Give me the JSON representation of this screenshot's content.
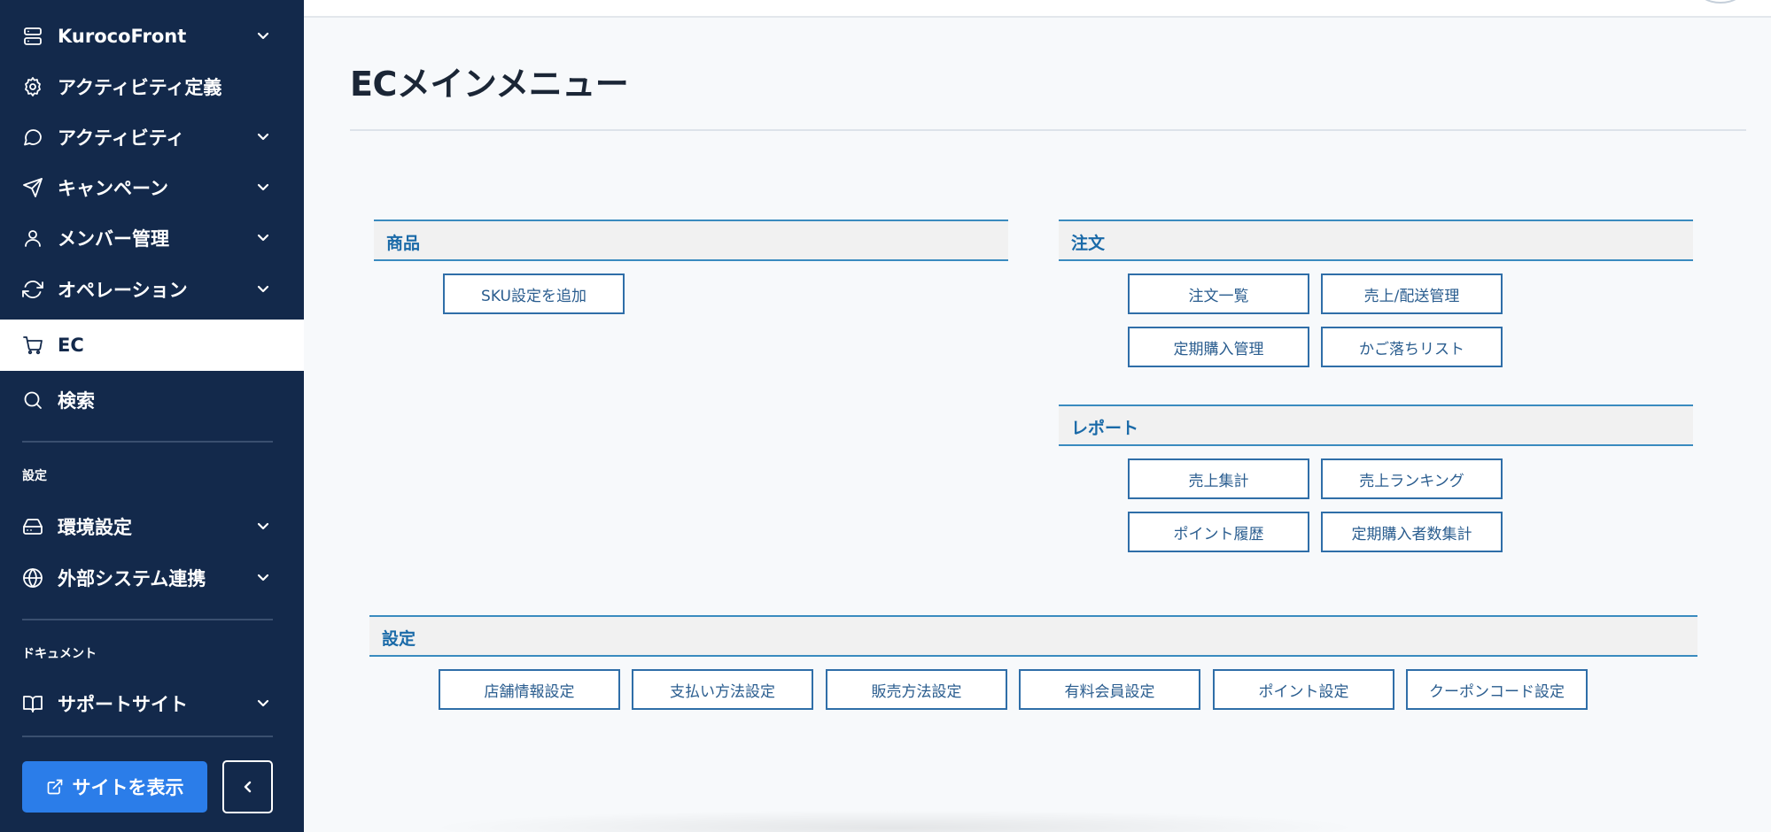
{
  "sidebar": {
    "items": [
      {
        "label": "KurocoFront",
        "icon": "server-icon",
        "expandable": true
      },
      {
        "label": "アクティビティ定義",
        "icon": "gear-icon",
        "expandable": false
      },
      {
        "label": "アクティビティ",
        "icon": "chat-bubble-icon",
        "expandable": true
      },
      {
        "label": "キャンペーン",
        "icon": "send-icon",
        "expandable": true
      },
      {
        "label": "メンバー管理",
        "icon": "user-icon",
        "expandable": true
      },
      {
        "label": "オペレーション",
        "icon": "refresh-icon",
        "expandable": true
      },
      {
        "label": "EC",
        "icon": "cart-icon",
        "expandable": false,
        "active": true
      },
      {
        "label": "検索",
        "icon": "search-icon",
        "expandable": false
      }
    ],
    "settings_label": "設定",
    "settings_items": [
      {
        "label": "環境設定",
        "icon": "hard-drive-icon",
        "expandable": true
      },
      {
        "label": "外部システム連携",
        "icon": "globe-icon",
        "expandable": true
      }
    ],
    "docs_label": "ドキュメント",
    "docs_items": [
      {
        "label": "サポートサイト",
        "icon": "book-icon",
        "expandable": true
      }
    ],
    "site_button_label": "サイトを表示"
  },
  "main": {
    "title": "ECメインメニュー",
    "sections": {
      "product": {
        "heading": "商品",
        "buttons": [
          "SKU設定を追加"
        ]
      },
      "order": {
        "heading": "注文",
        "buttons": [
          "注文一覧",
          "売上/配送管理",
          "定期購入管理",
          "かご落ちリスト"
        ]
      },
      "report": {
        "heading": "レポート",
        "buttons": [
          "売上集計",
          "売上ランキング",
          "ポイント履歴",
          "定期購入者数集計"
        ]
      },
      "settings": {
        "heading": "設定",
        "buttons": [
          "店舗情報設定",
          "支払い方法設定",
          "販売方法設定",
          "有料会員設定",
          "ポイント設定",
          "クーポンコード設定"
        ]
      }
    }
  },
  "colors": {
    "sidebar_bg": "#13294b",
    "accent_blue": "#2b7de9",
    "section_border": "#3a8bbf",
    "button_border": "#2f6ea8"
  }
}
